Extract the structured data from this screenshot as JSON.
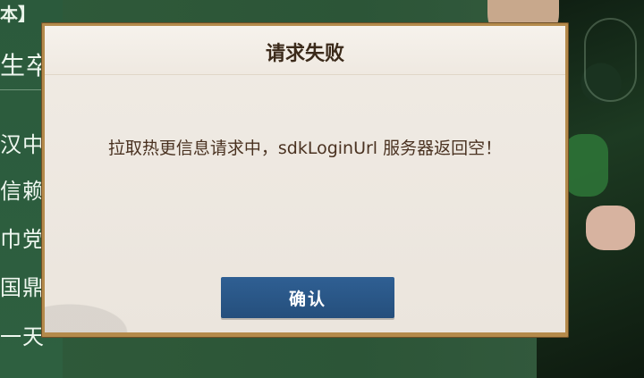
{
  "background": {
    "left_strip": {
      "top_label": "本】",
      "items": [
        "生卒",
        "汉中",
        "信赖",
        "巾党",
        "国鼎",
        "一天"
      ]
    }
  },
  "dialog": {
    "title": "请求失败",
    "message": "拉取热更信息请求中，sdkLoginUrl 服务器返回空！",
    "confirm_label": "确认"
  },
  "colors": {
    "frame": "#b48a4b",
    "panel": "#ebe5dd",
    "title_text": "#3b2a1a",
    "message_text": "#4a3221",
    "button": "#2a5887",
    "button_text": "#ffffff",
    "background_green": "#2f5a3a"
  }
}
